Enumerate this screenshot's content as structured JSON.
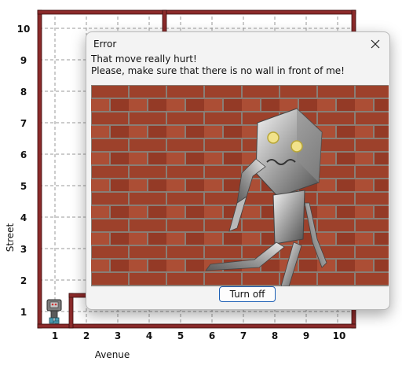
{
  "world": {
    "street_label": "Street",
    "avenue_label": "Avenue",
    "street_numbers": [
      "1",
      "2",
      "3",
      "4",
      "5",
      "6",
      "7",
      "8",
      "9",
      "10"
    ],
    "avenue_numbers": [
      "1",
      "2",
      "3",
      "4",
      "5",
      "6",
      "7",
      "8",
      "9",
      "10"
    ],
    "wall_color": "#8b2a2a",
    "robot_icon": "robot-icon"
  },
  "dialog": {
    "title": "Error",
    "close_icon": "close-icon",
    "message_line1": "That move really hurt!",
    "message_line2": "Please, make sure that there is no wall in front of me!",
    "button_label": "Turn off",
    "image_name": "robot-hitting-brick-wall"
  }
}
